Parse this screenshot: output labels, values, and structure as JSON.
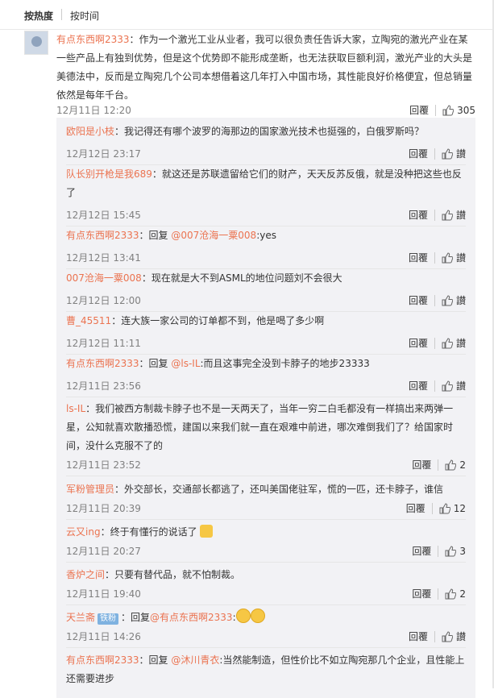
{
  "tabs": {
    "hot": "按热度",
    "time": "按时间"
  },
  "icons": {
    "like": "thumbs-up-icon"
  },
  "labels": {
    "reply": "回覆"
  },
  "main": {
    "user": "有点东西啊2333",
    "text": "：作为一个激光工业从业者，我可以很负责任告诉大家，立陶宛的激光产业在某一些产品上有独到优势，但是这个优势即不能形成垄断，也无法获取巨额利润，激光产业的大头是美德法中，反而是立陶宛几个公司本想借着这几年打入中国市场，其性能良好价格便宜，但总销量依然是每年千台。",
    "time": "12月11日 12:20",
    "likes": "305"
  },
  "replies": [
    {
      "user": "欧阳是小枝",
      "text": "：我记得还有哪个波罗的海那边的国家激光技术也挺强的，白俄罗斯吗？",
      "time": "12月12日 23:17",
      "likes": "讃"
    },
    {
      "user": "队长别开枪是我689",
      "text": "：就这还是苏联遗留给它们的财产，天天反苏反俄，就是没种把这些也反了",
      "time": "12月12日 15:45",
      "likes": "讃"
    },
    {
      "user": "有点东西啊2333",
      "text": "：回复 ",
      "mention": "@007沧海一粟008",
      "text2": ":yes",
      "time": "12月12日 13:41",
      "likes": "讃"
    },
    {
      "user": "007沧海一粟008",
      "text": "：现在就是大不到ASML的地位问题刘不会很大",
      "time": "12月12日 12:00",
      "likes": "讃"
    },
    {
      "user": "曹_45511",
      "text": "：连大族一家公司的订单都不到，他是喝了多少啊",
      "time": "12月12日 11:11",
      "likes": "讃"
    },
    {
      "user": "有点东西啊2333",
      "text": "：回复 ",
      "mention": "@ls-IL",
      "text2": ":而且这事完全没到卡脖子的地步23333",
      "time": "12月11日 23:56",
      "likes": "讃"
    },
    {
      "user": "ls-IL",
      "text": "：我们被西方制裁卡脖子也不是一天两天了，当年一穷二白毛都没有一样搞出来两弹一星，公知就喜欢散播恐慌，建国以来我们就一直在艰难中前进，哪次难倒我们了？给国家时间，没什么克服不了的",
      "time": "12月11日 23:52",
      "likes": "2"
    },
    {
      "user": "军粉管理员",
      "text": "：外交部长，交通部长都逃了，还叫美国佬驻军，慌的一匹，还卡脖子，谁信",
      "time": "12月11日 20:39",
      "likes": "12"
    },
    {
      "user": "云又ing",
      "text": "：终于有懂行的说话了",
      "time": "12月11日 20:27",
      "likes": "3"
    },
    {
      "user": "香炉之间",
      "text": "：只要有替代品，就不怕制裁。",
      "time": "12月11日 19:40",
      "likes": "2"
    },
    {
      "user": "天兰斋",
      "badge": "铁粉",
      "text": "：回复",
      "mention": "@有点东西啊2333",
      "text2": ":",
      "time": "12月11日 14:26",
      "likes": "讃"
    },
    {
      "user": "有点东西啊2333",
      "text": "：回复 ",
      "mention": "@沐川青衣",
      "text2": ":当然能制造，但性价比不如立陶宛那几个企业，且性能上还需要进步",
      "time": "",
      "likes": ""
    }
  ]
}
